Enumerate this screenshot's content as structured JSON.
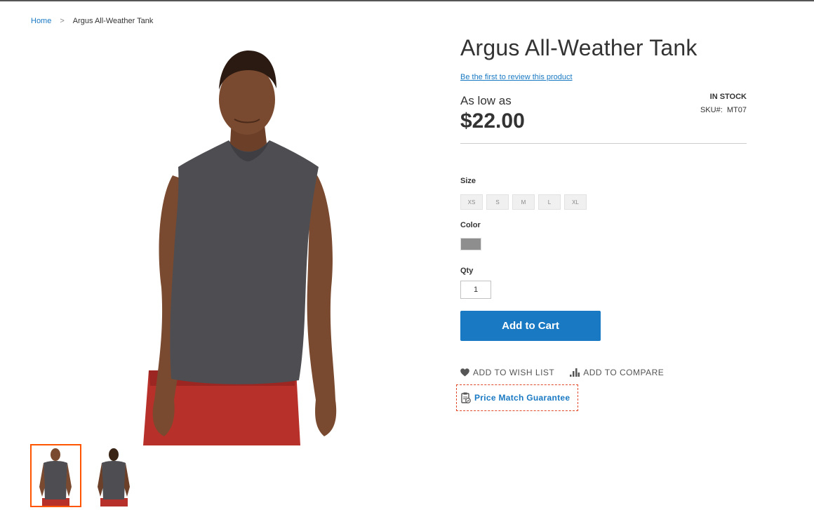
{
  "breadcrumb": {
    "home": "Home",
    "separator": ">",
    "current": "Argus All-Weather Tank"
  },
  "product": {
    "title": "Argus All-Weather Tank",
    "review_link": "Be the first to review this product",
    "price_prefix": "As low as",
    "price": "$22.00",
    "stock_status": "IN STOCK",
    "sku_label": "SKU#:",
    "sku": "MT07"
  },
  "options": {
    "size_label": "Size",
    "sizes": [
      "XS",
      "S",
      "M",
      "L",
      "XL"
    ],
    "color_label": "Color",
    "color_swatch": "#8e8e8e",
    "qty_label": "Qty",
    "qty_value": "1"
  },
  "buttons": {
    "add_to_cart": "Add to Cart"
  },
  "actions": {
    "wishlist": "ADD TO WISH LIST",
    "compare": "ADD TO COMPARE",
    "price_match": "Price Match Guarantee"
  },
  "gallery": {
    "thumbnails": [
      "front-view",
      "back-view"
    ],
    "active_thumbnail": 0
  },
  "colors": {
    "link": "#1979c3",
    "button": "#1979c3",
    "thumb_active": "#ff5501",
    "highlight_border": "#e04a2b"
  }
}
